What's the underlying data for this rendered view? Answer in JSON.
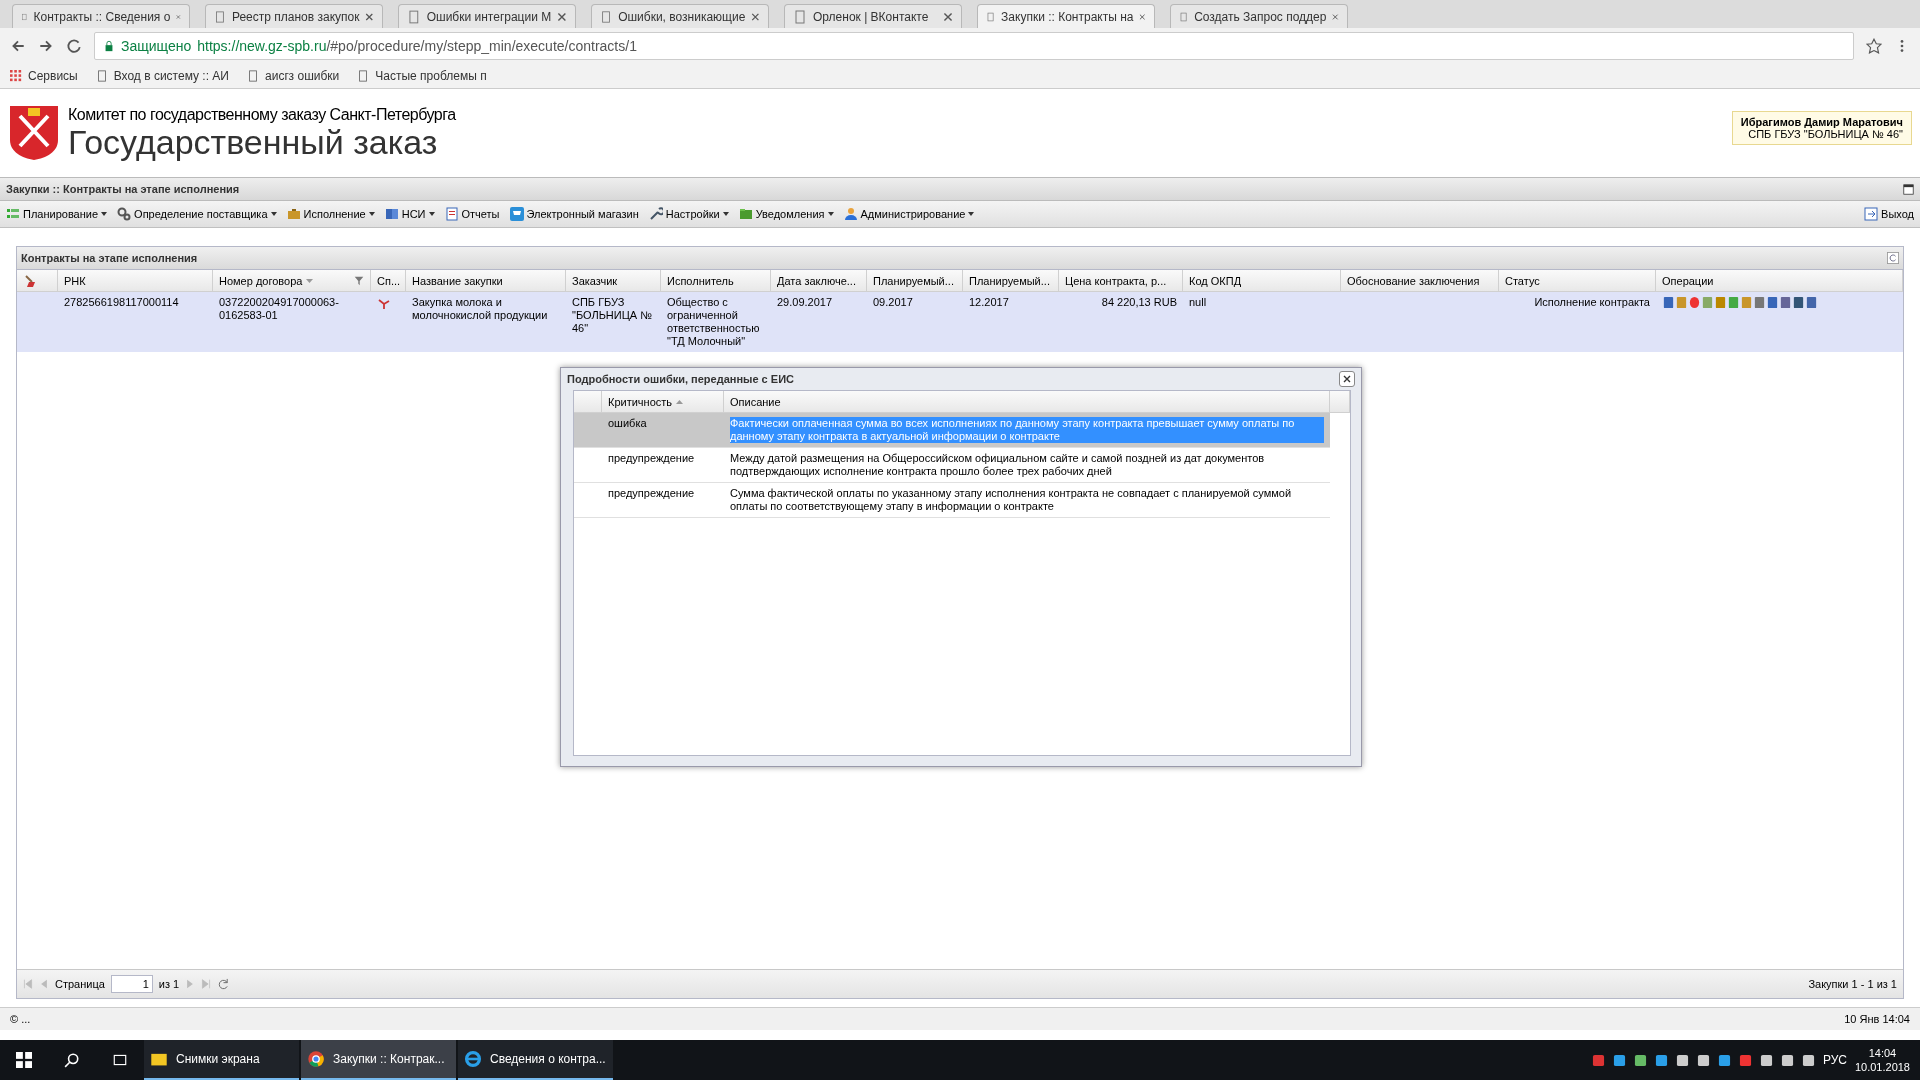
{
  "browser": {
    "tabs": [
      {
        "title": "Контракты :: Сведения о",
        "selected": false
      },
      {
        "title": "Реестр планов закупок",
        "selected": false
      },
      {
        "title": "Ошибки интеграции М",
        "selected": false
      },
      {
        "title": "Ошибки, возникающие",
        "selected": false
      },
      {
        "title": "Орленок | ВКонтакте",
        "selected": false
      },
      {
        "title": "Закупки :: Контракты на",
        "selected": true
      },
      {
        "title": "Создать Запрос поддер",
        "selected": false
      }
    ],
    "security": "Защищено",
    "url_host": "https://new.gz-spb.ru",
    "url_path": "/#po/procedure/my/stepp_min/execute/contracts/1",
    "bookmarks": [
      "Сервисы",
      "Вход в систему :: АИ",
      "аисгз ошибки",
      "Частые проблемы п"
    ]
  },
  "header": {
    "org": "Комитет по государственному заказу Санкт-Петербурга",
    "title": "Государственный заказ",
    "user_name": "Ибрагимов Дамир Маратович",
    "user_org": "СПБ ГБУЗ \"БОЛЬНИЦА № 46\""
  },
  "breadcrumb": "Закупки :: Контракты на этапе исполнения",
  "menu": [
    {
      "label": "Планирование",
      "dropdown": true
    },
    {
      "label": "Определение поставщика",
      "dropdown": true
    },
    {
      "label": "Исполнение",
      "dropdown": true
    },
    {
      "label": "НСИ",
      "dropdown": true
    },
    {
      "label": "Отчеты",
      "dropdown": false
    },
    {
      "label": "Электронный магазин",
      "dropdown": false
    },
    {
      "label": "Настройки",
      "dropdown": true
    },
    {
      "label": "Уведомления",
      "dropdown": true
    },
    {
      "label": "Администрирование",
      "dropdown": true
    }
  ],
  "logout": "Выход",
  "grid": {
    "title": "Контракты на этапе исполнения",
    "columns": [
      {
        "kind": "icon"
      },
      {
        "kind": "text",
        "label": "РНК"
      },
      {
        "kind": "text",
        "label": "Номер договора",
        "sort_ascending": false,
        "filter": true
      },
      {
        "kind": "flag",
        "label": "Сп..."
      },
      {
        "kind": "text",
        "label": "Название закупки"
      },
      {
        "kind": "text",
        "label": "Заказчик"
      },
      {
        "kind": "text",
        "label": "Исполнитель"
      },
      {
        "kind": "text",
        "label": "Дата заключе..."
      },
      {
        "kind": "text",
        "label": "Планируемый..."
      },
      {
        "kind": "text",
        "label": "Планируемый..."
      },
      {
        "kind": "number",
        "label": "Цена контракта, р..."
      },
      {
        "kind": "text",
        "label": "Код ОКПД"
      },
      {
        "kind": "blank",
        "label": "Обоснование заключения"
      },
      {
        "kind": "number",
        "label": "Статус"
      },
      {
        "kind": "ops",
        "label": "Операции"
      }
    ],
    "rows": [
      {
        "selected": true,
        "cells": [
          "",
          "2782566198117000114",
          "0372200204917000063-0162583-01",
          "",
          "Закупка молока и молочнокислой продукции",
          "СПБ ГБУЗ \"БОЛЬНИЦА № 46\"",
          "Общество с ограниченной ответственностью \"ТД Молочный\"",
          "29.09.2017",
          "09.2017",
          "12.2017",
          "84 220,13 RUB",
          "null",
          "",
          "Исполнение контракта",
          ""
        ]
      }
    ]
  },
  "pager": {
    "page_label": "Страница",
    "page": "1",
    "of": "из 1",
    "summary": "Закупки 1 - 1 из 1"
  },
  "status_bar": {
    "left": "© ...",
    "right": "10 Янв 14:04"
  },
  "dialog": {
    "title": "Подробности ошибки, переданные с ЕИС",
    "columns": [
      {
        "label": "Критичность",
        "sort_ascending": true
      },
      {
        "label": "Описание"
      }
    ],
    "rows": [
      {
        "severity": "ошибка",
        "description": "Фактически оплаченная сумма во всех исполнениях по данному этапу контракта превышает сумму оплаты по данному этапу контракта в актуальной информации о контракте",
        "selected": true
      },
      {
        "severity": "предупреждение",
        "description": "Между датой размещения на Общероссийском официальном сайте и самой поздней из дат документов подтверждающих исполнение контракта прошло более трех рабочих дней",
        "selected": false
      },
      {
        "severity": "предупреждение",
        "description": "Сумма фактической оплаты по указанному этапу исполнения контракта не совпадает с планируемой суммой оплаты по соответствующему этапу в информации о контракте",
        "selected": false
      }
    ]
  },
  "taskbar": {
    "items": [
      {
        "label": "Снимки экрана",
        "selected": false
      },
      {
        "label": "Закупки :: Контрак...",
        "selected": true
      },
      {
        "label": "Сведения о контра...",
        "selected": false
      }
    ],
    "lang": "РУС",
    "time": "14:04",
    "date": "10.01.2018"
  }
}
